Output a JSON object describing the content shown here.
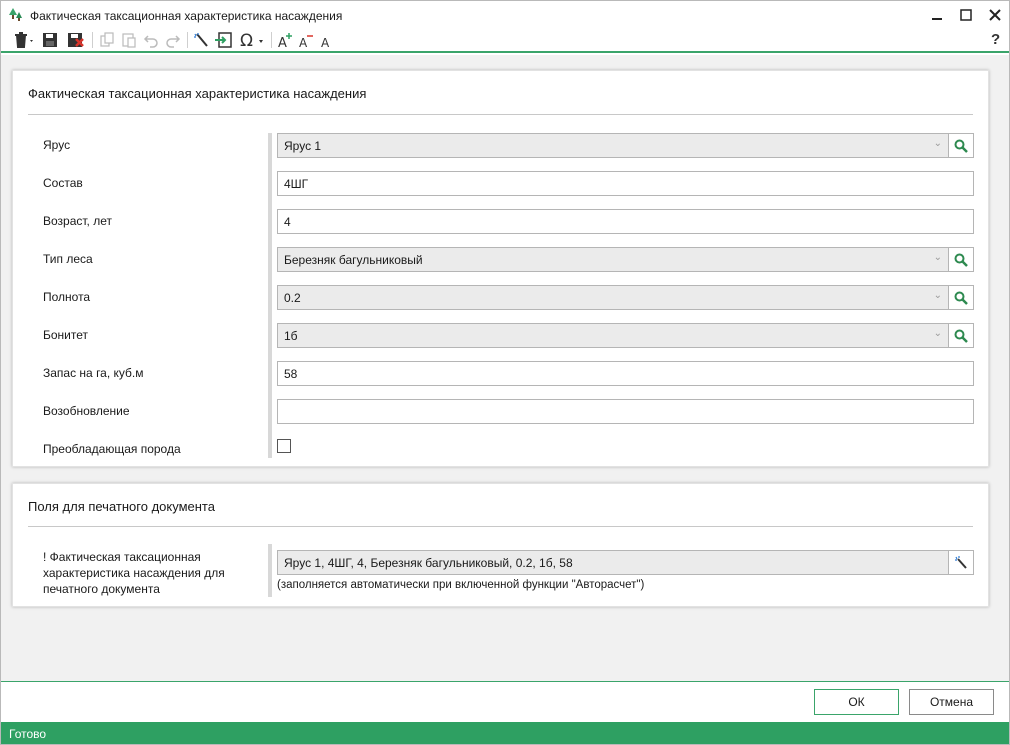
{
  "window": {
    "title": "Фактическая таксационная характеристика насаждения",
    "app_icon": "trees-icon",
    "controls": [
      "minimize-icon",
      "maximize-icon",
      "close-icon"
    ]
  },
  "toolbar": {
    "icons": [
      "delete-dropdown-icon",
      "save-icon",
      "save-close-icon",
      "copy-icon",
      "paste-icon",
      "undo-icon",
      "redo-icon",
      "magic-wand-icon",
      "import-icon",
      "symbol-omega-icon",
      "font-increase-icon",
      "font-decrease-icon",
      "font-default-icon",
      "help-icon"
    ],
    "help_label": "?"
  },
  "section1": {
    "title": "Фактическая таксационная характеристика насаждения",
    "fields": {
      "tier": {
        "label": "Ярус",
        "value": "Ярус 1"
      },
      "composition": {
        "label": "Состав",
        "value": "4ШГ"
      },
      "age": {
        "label": "Возраст, лет",
        "value": "4"
      },
      "forest_type": {
        "label": "Тип леса",
        "value": "Березняк багульниковый"
      },
      "density": {
        "label": "Полнота",
        "value": "0.2"
      },
      "bonitet": {
        "label": "Бонитет",
        "value": "1б"
      },
      "stock": {
        "label": "Запас на га, куб.м",
        "value": "58"
      },
      "renewal": {
        "label": "Возобновление",
        "value": ""
      },
      "dominant": {
        "label": "Преобладающая порода",
        "checked": false
      }
    }
  },
  "section2": {
    "title": "Поля для печатного документа",
    "print_field": {
      "label_line1": "! Фактическая таксационная",
      "label_line2": "характеристика насаждения для",
      "label_line3": "печатного документа",
      "value": "Ярус 1, 4ШГ, 4, Березняк багульниковый, 0.2, 1б, 58",
      "hint": "(заполняется автоматически при включенной функции \"Авторасчет\")"
    }
  },
  "buttons": {
    "ok": "ОК",
    "cancel": "Отмена"
  },
  "status": {
    "text": "Готово"
  },
  "colors": {
    "accent": "#2ea062",
    "accent_line": "#3aa46a"
  }
}
